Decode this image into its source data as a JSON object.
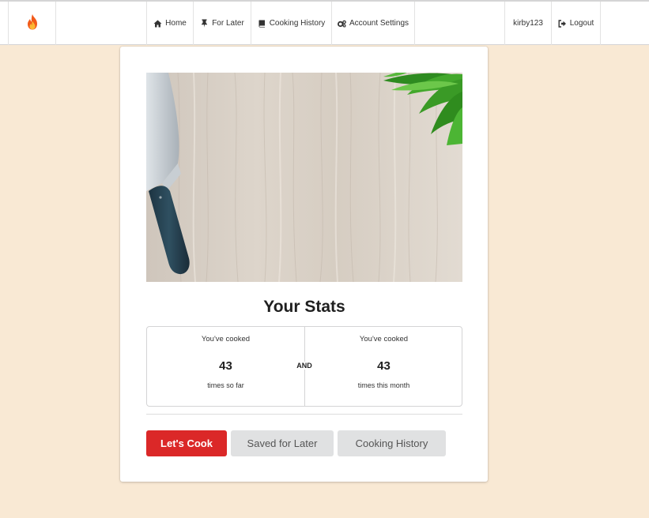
{
  "nav": {
    "logo_icon": "fire-icon",
    "home_label": "Home",
    "home_icon": "home-icon",
    "forlater_label": "For Later",
    "forlater_icon": "pin-icon",
    "history_label": "Cooking History",
    "history_icon": "book-icon",
    "account_label": "Account Settings",
    "account_icon": "gears-icon",
    "username": "kirby123",
    "logout_label": "Logout",
    "logout_icon": "sign-out-icon"
  },
  "hero": {
    "image": "knife-on-wooden-board-with-greens-photo"
  },
  "stats": {
    "title": "Your Stats",
    "left_label": "You've cooked",
    "left_value": "43",
    "left_caption": "times so far",
    "and_label": "AND",
    "right_label": "You've cooked",
    "right_value": "43",
    "right_caption": "times this month"
  },
  "actions": {
    "cook_label": "Let's Cook",
    "saved_label": "Saved for Later",
    "history_label": "Cooking History"
  },
  "colors": {
    "page_background": "#f9e9d4",
    "primary_button": "#db2828",
    "secondary_button": "#e0e1e2"
  }
}
